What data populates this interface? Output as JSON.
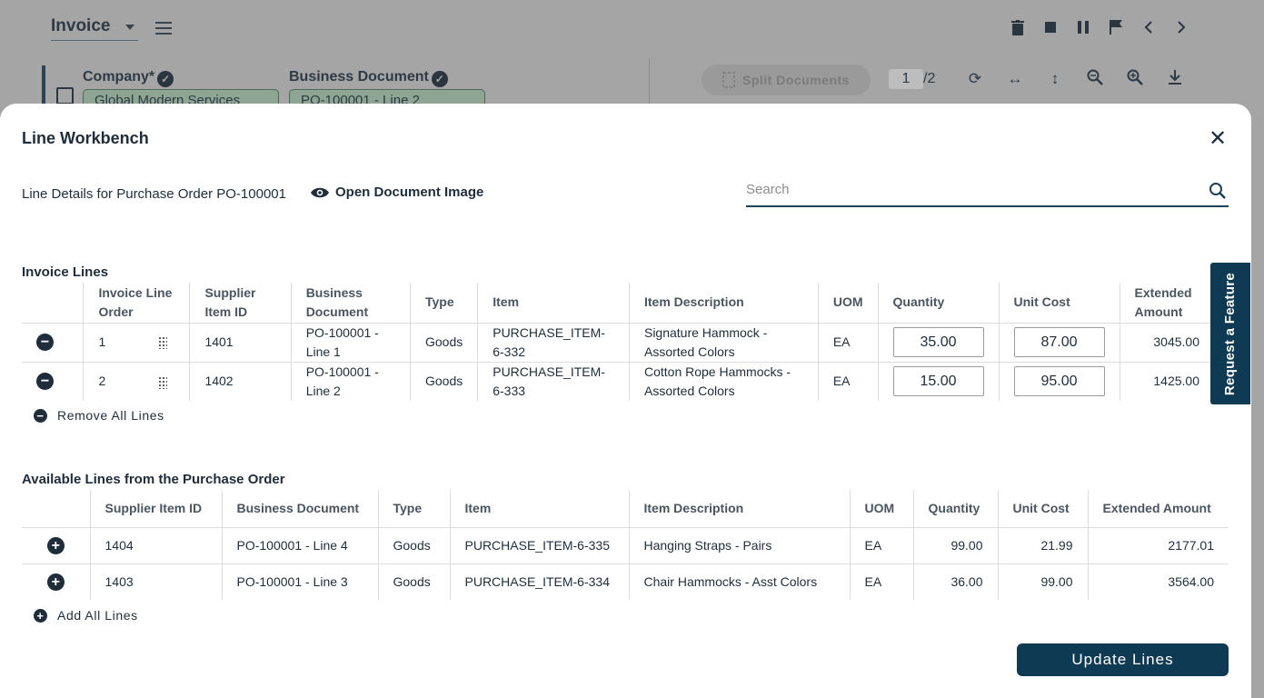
{
  "background": {
    "title": "Invoice",
    "company_label": "Company*",
    "company_value": "Global Modern Services",
    "business_doc_label": "Business Document",
    "business_doc_value": "PO-100001 - Line 2",
    "split_label": "Split Documents",
    "page_current": "1",
    "page_total": "/2"
  },
  "modal": {
    "title": "Line Workbench",
    "subtitle": "Line Details for Purchase Order PO-100001",
    "open_image_label": "Open Document Image",
    "search_placeholder": "Search",
    "invoice_section_title": "Invoice Lines",
    "invoice_headers": [
      "Invoice Line Order",
      "Supplier Item ID",
      "Business Document",
      "Type",
      "Item",
      "Item Description",
      "UOM",
      "Quantity",
      "Unit Cost",
      "Extended Amount"
    ],
    "invoice_lines": [
      {
        "order": "1",
        "supplier_id": "1401",
        "doc": "PO-100001 - Line 1",
        "type": "Goods",
        "item": "PURCHASE_ITEM-6-332",
        "desc": "Signature Hammock - Assorted Colors",
        "uom": "EA",
        "qty": "35.00",
        "unit": "87.00",
        "ext": "3045.00"
      },
      {
        "order": "2",
        "supplier_id": "1402",
        "doc": "PO-100001 - Line 2",
        "type": "Goods",
        "item": "PURCHASE_ITEM-6-333",
        "desc": "Cotton Rope Hammocks - Assorted Colors",
        "uom": "EA",
        "qty": "15.00",
        "unit": "95.00",
        "ext": "1425.00"
      }
    ],
    "remove_all_label": "Remove All Lines",
    "available_section_title": "Available Lines from the Purchase Order",
    "available_headers": [
      "Supplier Item ID",
      "Business Document",
      "Type",
      "Item",
      "Item Description",
      "UOM",
      "Quantity",
      "Unit Cost",
      "Extended Amount"
    ],
    "available_lines": [
      {
        "supplier_id": "1404",
        "doc": "PO-100001 - Line 4",
        "type": "Goods",
        "item": "PURCHASE_ITEM-6-335",
        "desc": "Hanging Straps - Pairs",
        "uom": "EA",
        "qty": "99.00",
        "unit": "21.99",
        "ext": "2177.01"
      },
      {
        "supplier_id": "1403",
        "doc": "PO-100001 - Line 3",
        "type": "Goods",
        "item": "PURCHASE_ITEM-6-334",
        "desc": "Chair Hammocks - Asst Colors",
        "uom": "EA",
        "qty": "36.00",
        "unit": "99.00",
        "ext": "3564.00"
      }
    ],
    "add_all_label": "Add All Lines",
    "update_button": "Update Lines"
  },
  "feature_tab": "Request a Feature",
  "colors": {
    "primary": "#0f3a53",
    "text": "#1f2d3a",
    "overlay": "#a5a5a5"
  }
}
